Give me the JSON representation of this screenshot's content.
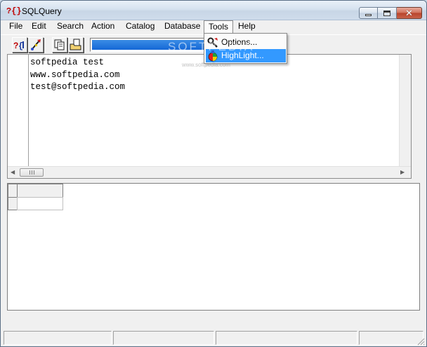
{
  "window": {
    "title": "SQLQuery",
    "icon_text": "?{}"
  },
  "title_buttons": {
    "minimize_glyph": "",
    "maximize_glyph": "",
    "close_glyph": "✕"
  },
  "menubar": {
    "items": [
      "File",
      "Edit",
      "Search",
      "Action",
      "Catalog",
      "Database",
      "Tools",
      "Help"
    ],
    "open_item": "Tools"
  },
  "tools_menu": {
    "items": [
      {
        "label": "Options...",
        "icon": "wrench-gear-icon"
      },
      {
        "label": "HighLight...",
        "icon": "highlight-palette-icon",
        "highlighted": true
      }
    ]
  },
  "toolbar": {
    "buttons": [
      {
        "name": "query-help",
        "icon": "query-help-icon"
      },
      {
        "name": "execute",
        "icon": "brush-execute-icon"
      },
      {
        "name": "copy",
        "icon": "copy-icon"
      },
      {
        "name": "open",
        "icon": "open-folder-icon"
      }
    ],
    "progress_fraction": 1.0
  },
  "editor": {
    "lines": [
      "softpedia test",
      "www.softpedia.com",
      "test@softpedia.com"
    ]
  },
  "watermark": {
    "text": "SOFTPEDIA",
    "sub": "www.softpedia.com"
  },
  "statusbar": {
    "panels": [
      "",
      "",
      "",
      ""
    ]
  },
  "colors": {
    "menu_highlight": "#3399ff",
    "progress": "#1467d6",
    "icon_red": "#c00000"
  }
}
